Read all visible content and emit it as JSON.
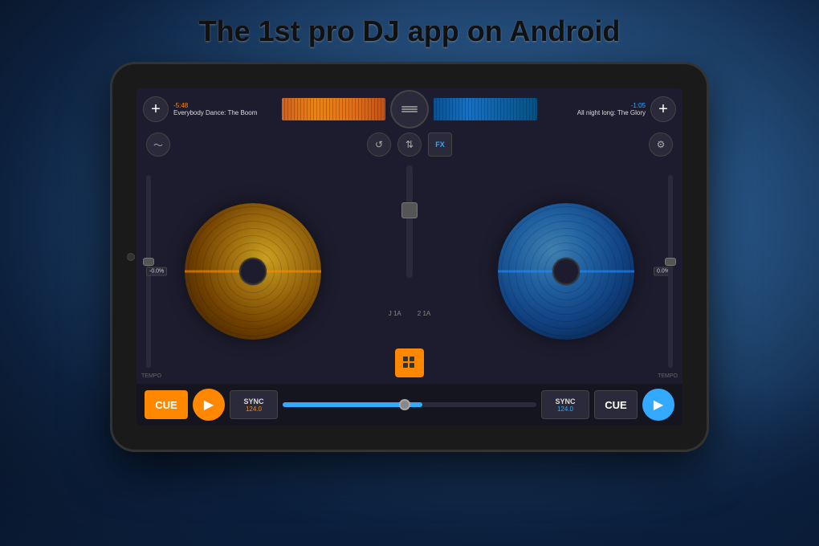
{
  "headline": "The 1st pro DJ app on Android",
  "tablet": {
    "top_bar": {
      "add_left": "+",
      "track_left_time": "-5:48",
      "track_left_name": "Everybody Dance: The Boom",
      "add_right": "+",
      "track_right_time": "-1:05",
      "track_right_name": "All night long: The Glory"
    },
    "controls": {
      "waveform_icon": "〜",
      "sync_icon": "↺",
      "eq_icon": "⇅",
      "fx_label": "FX",
      "settings_icon": "⚙"
    },
    "decks": {
      "left_pitch": "-0.0%",
      "right_pitch": "0.0%",
      "tempo_label": "TEMPO",
      "deck_label_left": "J 1A",
      "deck_label_right": "2 1A"
    },
    "bottom": {
      "cue_left": "CUE",
      "play_left": "▶",
      "sync_label": "SYNC",
      "sync_bpm_left": "124.0",
      "sync_bpm_right": "124.0",
      "cue_right": "CUE",
      "play_right": "▶"
    }
  }
}
